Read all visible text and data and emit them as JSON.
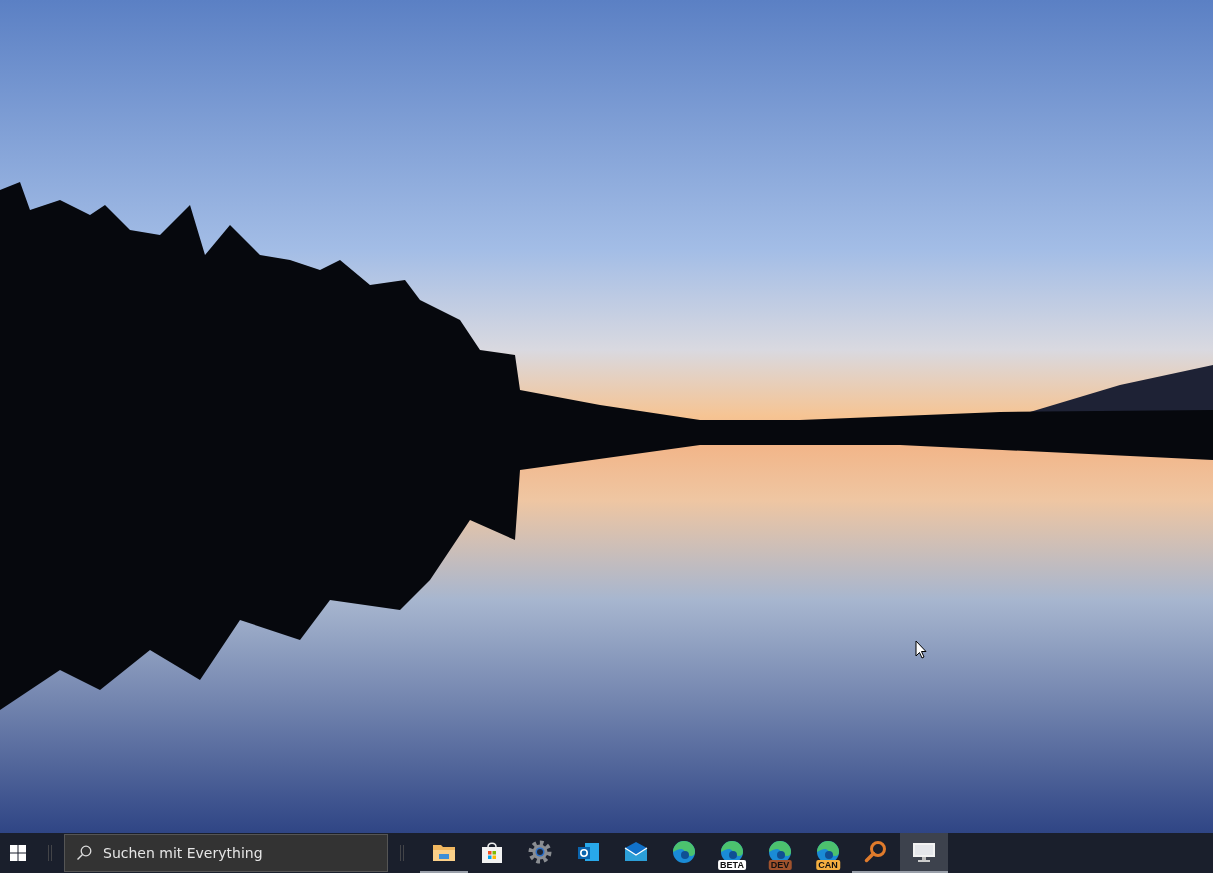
{
  "search": {
    "placeholder": "Suchen mit Everything"
  },
  "taskbar_apps": [
    {
      "kind": "folder",
      "running": true,
      "selected": false
    },
    {
      "kind": "store",
      "running": false,
      "selected": false
    },
    {
      "kind": "gear",
      "running": false,
      "selected": false
    },
    {
      "kind": "outlook",
      "running": false,
      "selected": false
    },
    {
      "kind": "mail",
      "running": false,
      "selected": false
    },
    {
      "kind": "edge",
      "running": false,
      "selected": false
    },
    {
      "kind": "edge",
      "badge": "BETA",
      "color": "#ffffff",
      "running": false,
      "selected": false
    },
    {
      "kind": "edge",
      "badge": "DEV",
      "color": "#a0522d",
      "running": false,
      "selected": false
    },
    {
      "kind": "edge",
      "badge": "CAN",
      "color": "#f5b041",
      "running": false,
      "selected": false
    },
    {
      "kind": "magnifier",
      "running": true,
      "selected": false
    },
    {
      "kind": "monitor",
      "running": true,
      "selected": true
    }
  ]
}
